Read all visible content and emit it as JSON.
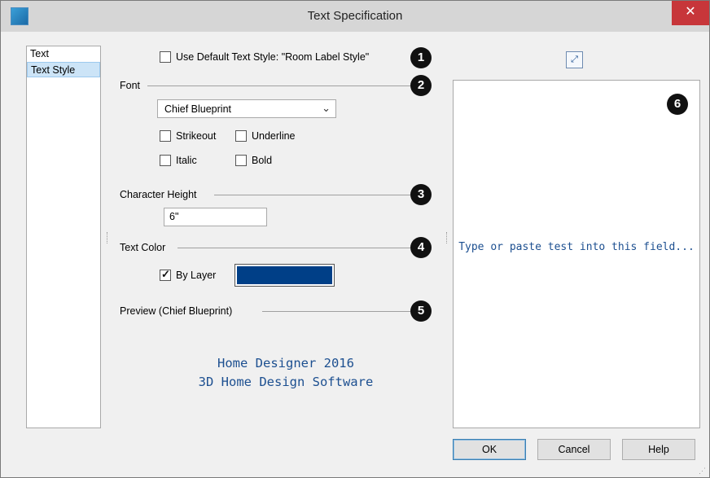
{
  "window": {
    "title": "Text Specification",
    "close_label": "✕"
  },
  "nav": {
    "items": [
      {
        "label": "Text",
        "selected": false
      },
      {
        "label": "Text Style",
        "selected": true
      }
    ]
  },
  "use_default": {
    "checked": false,
    "label": "Use Default Text Style: \"Room Label Style\""
  },
  "font": {
    "heading": "Font",
    "selected_font": "Chief Blueprint",
    "strikeout_label": "Strikeout",
    "underline_label": "Underline",
    "italic_label": "Italic",
    "bold_label": "Bold",
    "strikeout": false,
    "underline": false,
    "italic": false,
    "bold": false
  },
  "character_height": {
    "heading": "Character Height",
    "value": "6\""
  },
  "text_color": {
    "heading": "Text Color",
    "by_layer_label": "By Layer",
    "by_layer": true,
    "swatch_color": "#003f87"
  },
  "preview": {
    "heading": "Preview (Chief Blueprint)",
    "line1": "Home Designer 2016",
    "line2": "3D Home Design Software"
  },
  "text_field": {
    "placeholder": "Type or paste test into this field..."
  },
  "callouts": [
    "1",
    "2",
    "3",
    "4",
    "5",
    "6"
  ],
  "buttons": {
    "ok": "OK",
    "cancel": "Cancel",
    "help": "Help"
  },
  "colors": {
    "accent_text": "#1c4f90",
    "close_button": "#c7363a",
    "selection": "#cce4f7"
  }
}
